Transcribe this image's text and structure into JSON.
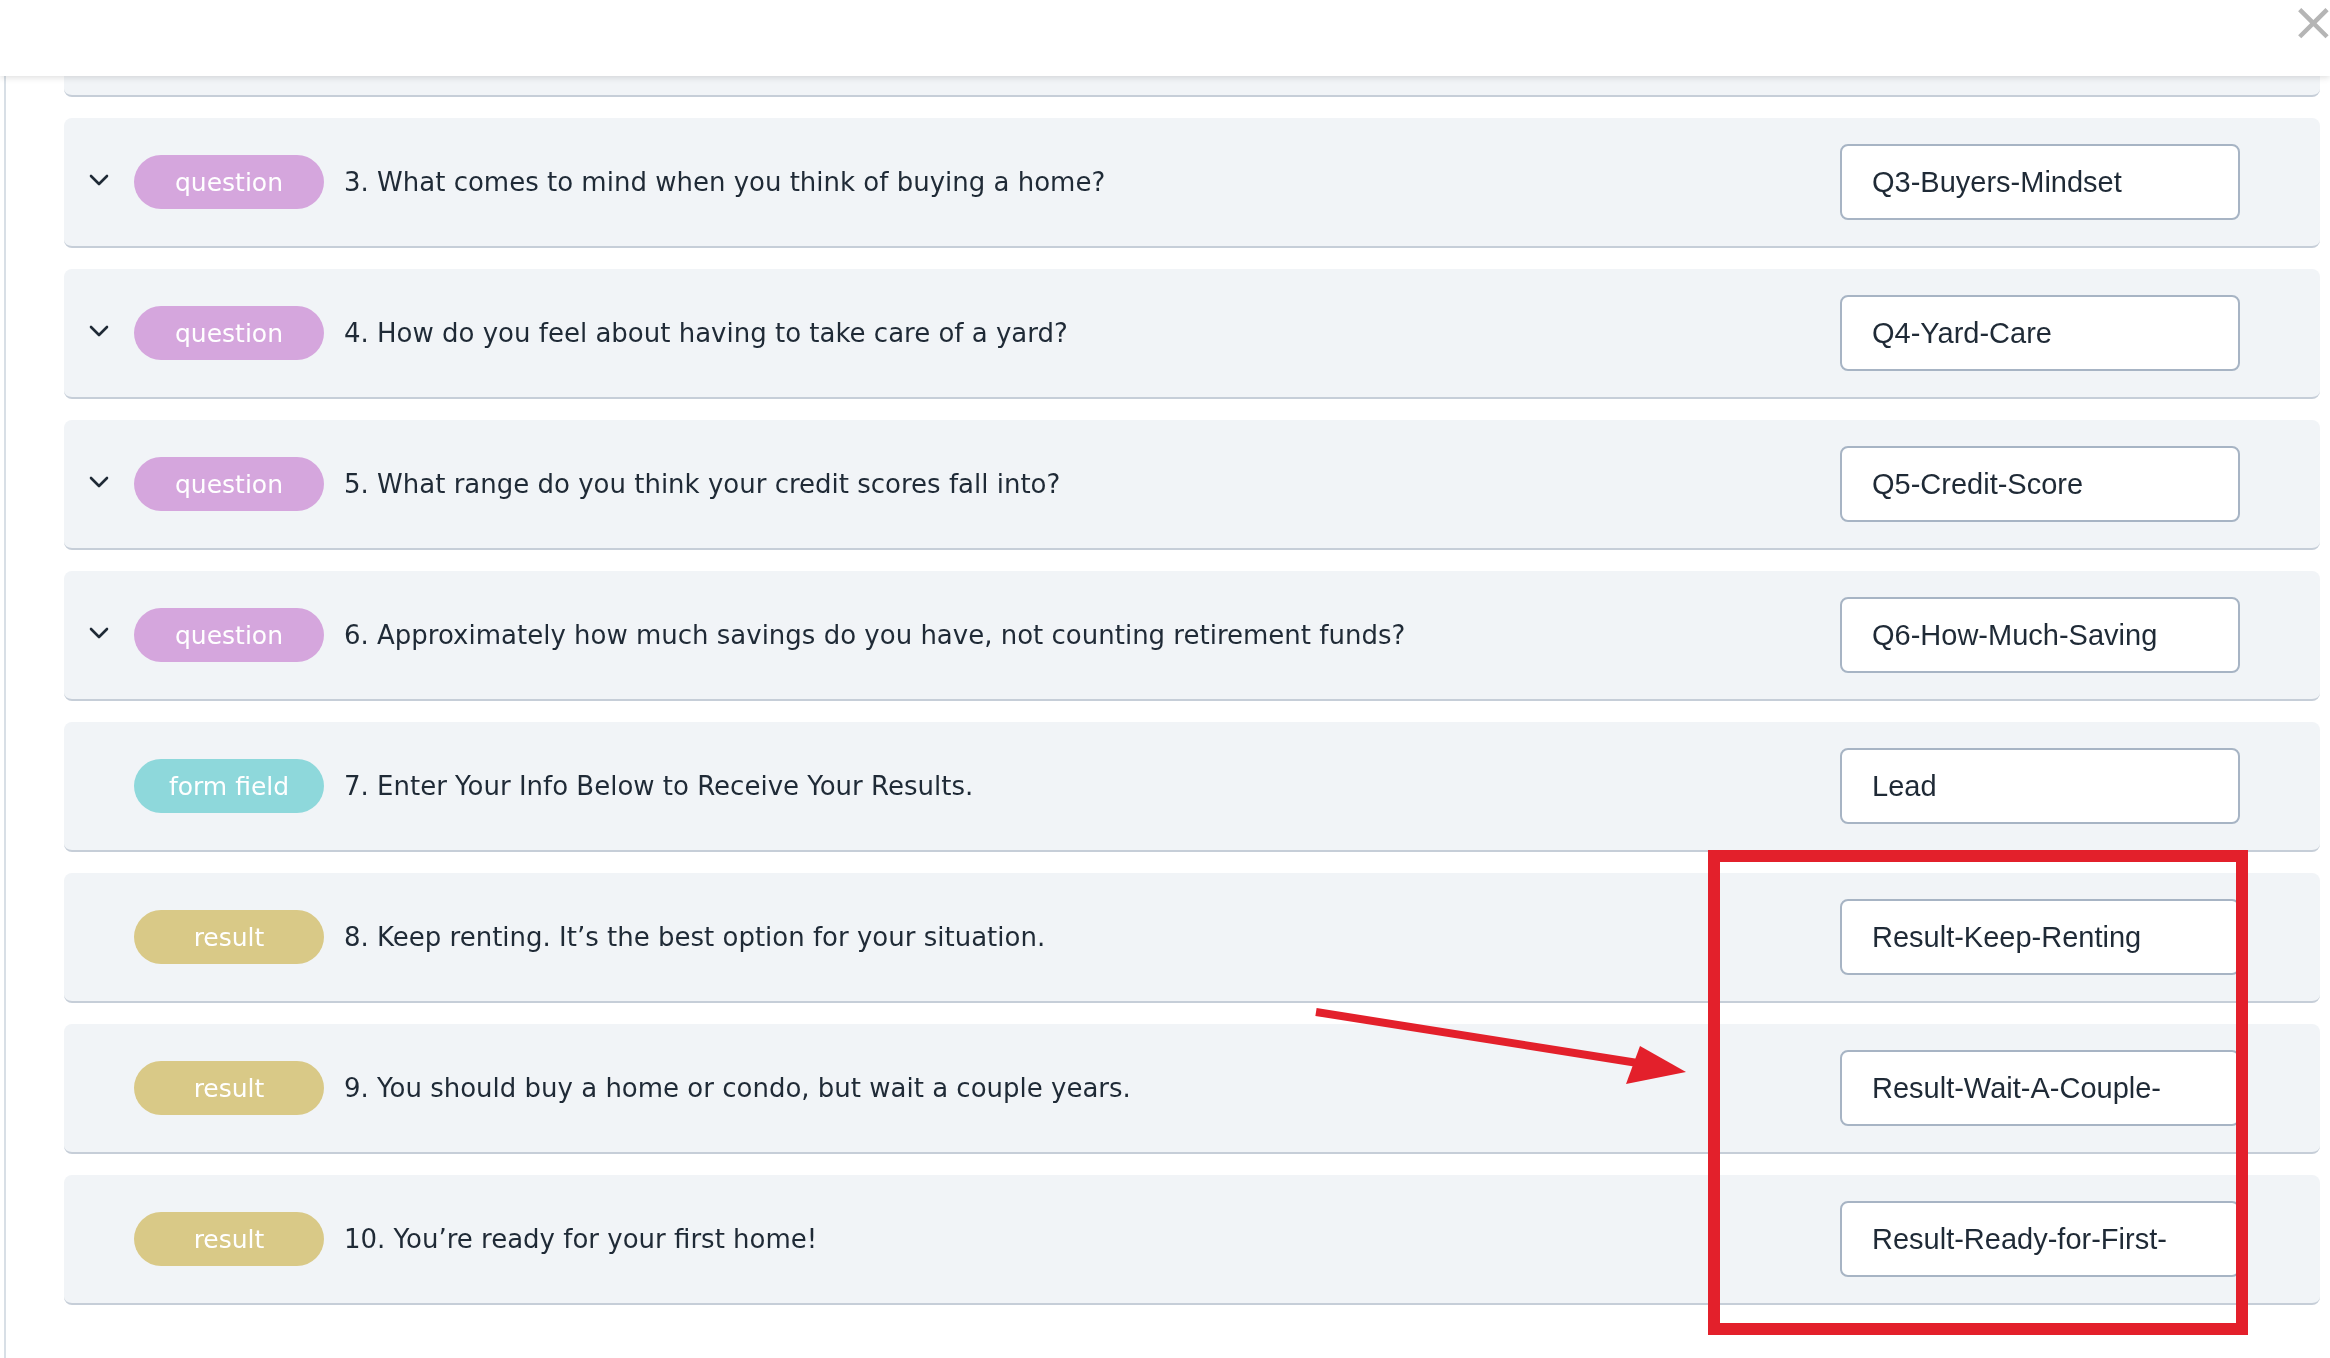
{
  "close_label": "×",
  "items": [
    {
      "kind": "question",
      "tag": "question",
      "color": "#d5a6dd",
      "text": "3. What comes to mind when you think of buying a home?",
      "field_value": "Q3-Buyers-Mindset"
    },
    {
      "kind": "question",
      "tag": "question",
      "color": "#d5a6dd",
      "text": "4. How do you feel about having to take care of a yard?",
      "field_value": "Q4-Yard-Care"
    },
    {
      "kind": "question",
      "tag": "question",
      "color": "#d5a6dd",
      "text": "5. What range do you think your credit scores fall into?",
      "field_value": "Q5-Credit-Score"
    },
    {
      "kind": "question",
      "tag": "question",
      "color": "#d5a6dd",
      "text": "6. Approximately how much savings do you have, not counting retirement funds?",
      "field_value": "Q6-How-Much-Saving"
    },
    {
      "kind": "form",
      "tag": "form field",
      "color": "#8ed8db",
      "text": "7. Enter Your Info Below to Receive Your Results.",
      "field_value": "Lead"
    },
    {
      "kind": "result",
      "tag": "result",
      "color": "#d9c987",
      "text": "8. Keep renting. It’s the best option for your situation.",
      "field_value": "Result-Keep-Renting"
    },
    {
      "kind": "result",
      "tag": "result",
      "color": "#d9c987",
      "text": "9. You should buy a home or condo, but wait a couple years.",
      "field_value": "Result-Wait-A-Couple-"
    },
    {
      "kind": "result",
      "tag": "result",
      "color": "#d9c987",
      "text": "10. You’re ready for your first home!",
      "field_value": "Result-Ready-for-First-"
    }
  ]
}
